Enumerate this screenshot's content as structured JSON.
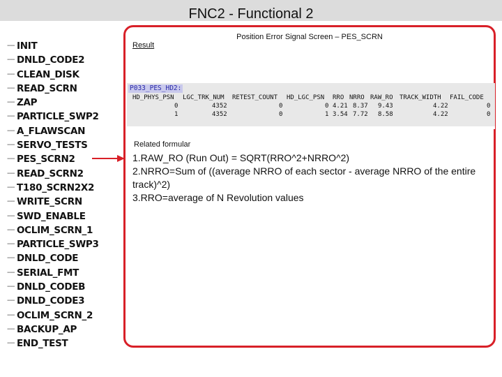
{
  "header": {
    "title": "FNC2 - Functional 2"
  },
  "tree": {
    "items": [
      "INIT",
      "DNLD_CODE2",
      "CLEAN_DISK",
      "READ_SCRN",
      "ZAP",
      "PARTICLE_SWP2",
      "A_FLAWSCAN",
      "SERVO_TESTS",
      "PES_SCRN2",
      "READ_SCRN2",
      "T180_SCRN2X2",
      "WRITE_SCRN",
      "SWD_ENABLE",
      "OCLIM_SCRN_1",
      "PARTICLE_SWP3",
      "DNLD_CODE",
      "SERIAL_FMT",
      "DNLD_CODEB",
      "DNLD_CODE3",
      "OCLIM_SCRN_2",
      "BACKUP_AP",
      "END_TEST"
    ],
    "selected": "PES_SCRN2"
  },
  "panel": {
    "title": "Position Error Signal Screen – PES_SCRN",
    "result_label": "Result",
    "command": "P033_PES_HD2:",
    "table": {
      "columns": [
        "HD_PHYS_PSN",
        "LGC_TRK_NUM",
        "RETEST_COUNT",
        "HD_LGC_PSN",
        "RRO",
        "NRRO",
        "RAW_RO",
        "TRACK_WIDTH",
        "FAIL_CODE"
      ],
      "rows": [
        [
          "0",
          "4352",
          "0",
          "0",
          "4.21",
          "8.37",
          "9.43",
          "4.22",
          "0"
        ],
        [
          "1",
          "4352",
          "0",
          "1",
          "3.54",
          "7.72",
          "8.58",
          "4.22",
          "0"
        ]
      ]
    },
    "formula_label": "Related formular",
    "formulas": [
      "1.RAW_RO (Run Out) = SQRT(RRO^2+NRRO^2)",
      "2.NRRO=Sum of ((average NRRO of each sector - average NRRO of the entire track)^2)",
      "3.RRO=average of N  Revolution values"
    ]
  },
  "colors": {
    "accent": "#d82028",
    "title_bar": "#dcdcdc",
    "console": "#e8e8e8",
    "command_text": "#2a2aa8"
  }
}
